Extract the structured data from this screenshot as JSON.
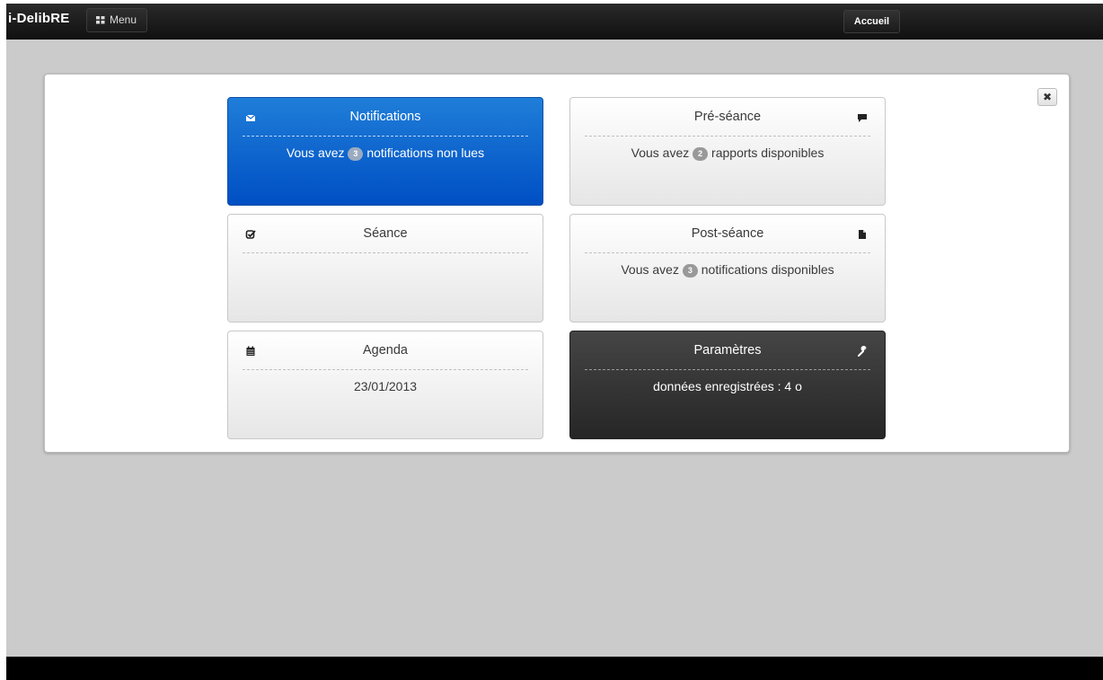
{
  "header": {
    "brand": "i-DelibRE",
    "menu_label": "Menu",
    "home_label": "Accueil"
  },
  "dialog": {
    "close_icon": "close-icon",
    "tiles": {
      "notifications": {
        "title": "Notifications",
        "icon": "envelope-icon",
        "text_before": "Vous avez",
        "count": "3",
        "text_after": "notifications non lues"
      },
      "pre_seance": {
        "title": "Pré-séance",
        "icon": "comment-icon",
        "text_before": "Vous avez",
        "count": "2",
        "text_after": "rapports disponibles"
      },
      "seance": {
        "title": "Séance",
        "icon": "check-icon"
      },
      "post_seance": {
        "title": "Post-séance",
        "icon": "file-icon",
        "text_before": "Vous avez",
        "count": "3",
        "text_after": "notifications disponibles"
      },
      "agenda": {
        "title": "Agenda",
        "icon": "calendar-icon",
        "date": "23/01/2013"
      },
      "parametres": {
        "title": "Paramètres",
        "icon": "wrench-icon",
        "text": "données enregistrées : 4 o"
      }
    }
  },
  "colors": {
    "accent_blue": "#0a5fd0",
    "dark_tile": "#333333",
    "background": "#cbcbcb"
  }
}
